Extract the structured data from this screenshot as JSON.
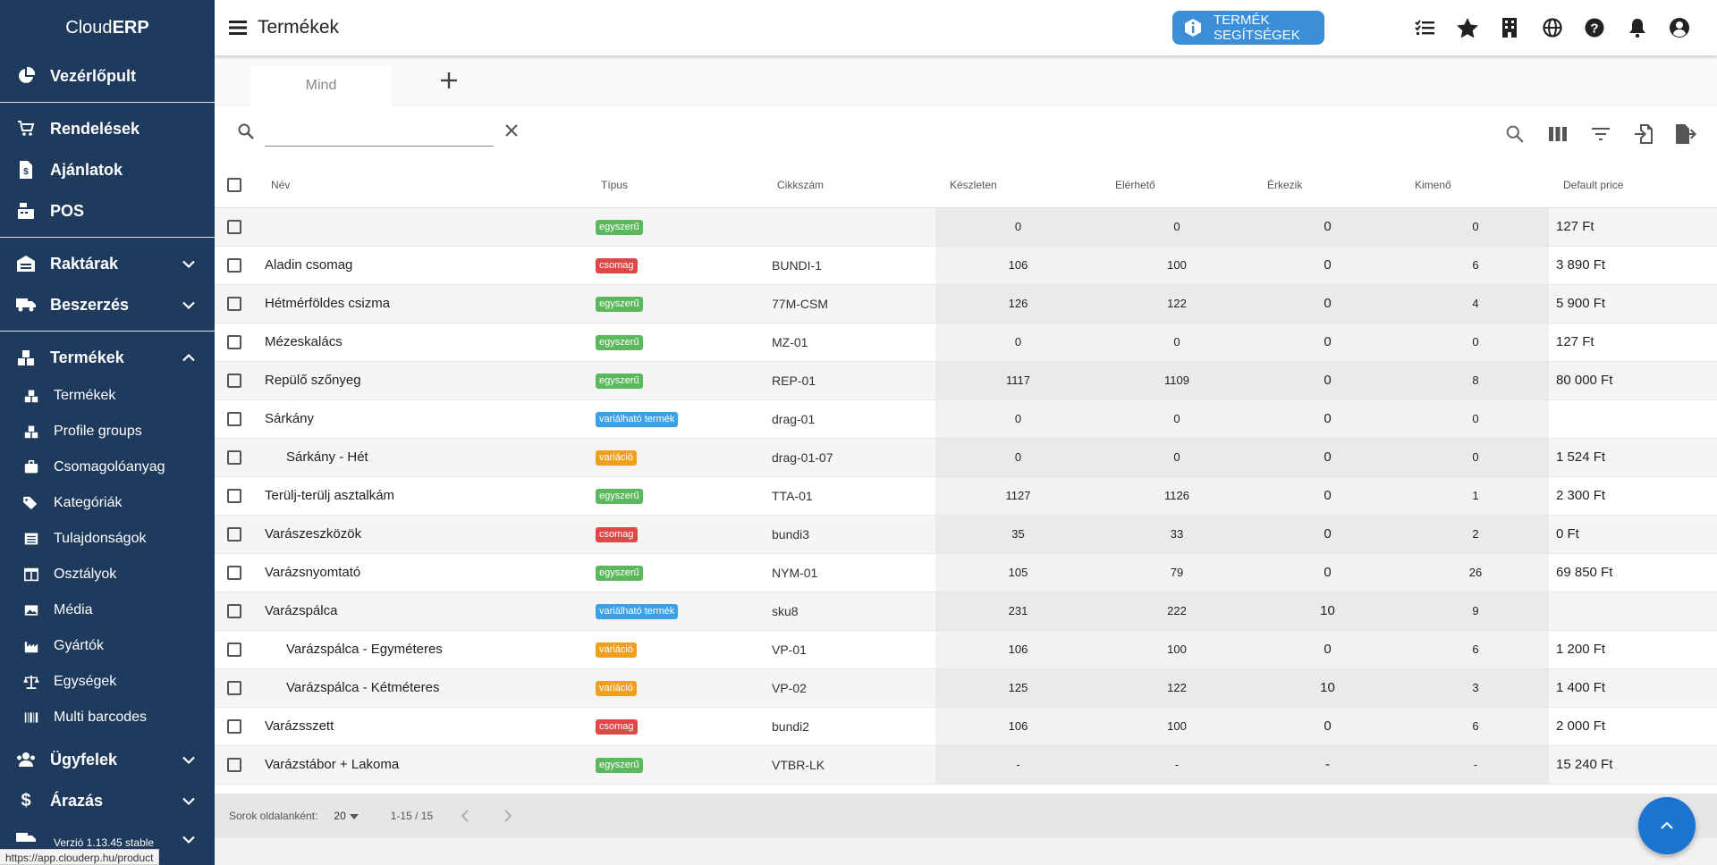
{
  "app": {
    "brand_prefix": "Cloud",
    "brand_suffix": "ERP",
    "status_url": "https://app.clouderp.hu/product",
    "version": "Verzió 1.13.45 stable"
  },
  "sidebar": {
    "dashboard": "Vezérlőpult",
    "orders": "Rendelések",
    "offers": "Ajánlatok",
    "pos": "POS",
    "warehouses": "Raktárak",
    "purchasing": "Beszerzés",
    "products": "Termékek",
    "sub": [
      "Termékek",
      "Profile groups",
      "Csomagolóanyag",
      "Kategóriák",
      "Tulajdonságok",
      "Osztályok",
      "Média",
      "Gyártók",
      "Egységek",
      "Multi barcodes"
    ],
    "customers": "Ügyfelek",
    "pricing": "Árazás"
  },
  "header": {
    "title": "Termékek",
    "help_label": "TERMÉK SEGÍTSÉGEK"
  },
  "tabs": {
    "all": "Mind"
  },
  "search": {
    "value": "",
    "placeholder": ""
  },
  "table": {
    "columns": [
      "Név",
      "Típus",
      "Cikkszám",
      "Készleten",
      "Elérhető",
      "Érkezik",
      "Kimenő",
      "Default price"
    ],
    "rows": [
      {
        "name": "",
        "type": "egyszerű",
        "sku": "",
        "stock": "0",
        "available": "0",
        "incoming": "0",
        "outgoing": "0",
        "price": "127 Ft"
      },
      {
        "name": "Aladin csomag",
        "type": "csomag",
        "sku": "BUNDI-1",
        "stock": "106",
        "available": "100",
        "incoming": "0",
        "outgoing": "6",
        "price": "3 890 Ft"
      },
      {
        "name": "Hétmérföldes csizma",
        "type": "egyszerű",
        "sku": "77M-CSM",
        "stock": "126",
        "available": "122",
        "incoming": "0",
        "outgoing": "4",
        "price": "5 900 Ft"
      },
      {
        "name": "Mézeskalács",
        "type": "egyszerű",
        "sku": "MZ-01",
        "stock": "0",
        "available": "0",
        "incoming": "0",
        "outgoing": "0",
        "price": "127 Ft"
      },
      {
        "name": "Repülő szőnyeg",
        "type": "egyszerű",
        "sku": "REP-01",
        "stock": "1117",
        "available": "1109",
        "incoming": "0",
        "outgoing": "8",
        "price": "80 000 Ft"
      },
      {
        "name": "Sárkány",
        "type": "variálható termék",
        "sku": "drag-01",
        "stock": "0",
        "available": "0",
        "incoming": "0",
        "outgoing": "0",
        "price": ""
      },
      {
        "name": "Sárkány - Hét",
        "type": "variáció",
        "sku": "drag-01-07",
        "stock": "0",
        "available": "0",
        "incoming": "0",
        "outgoing": "0",
        "price": "1 524 Ft"
      },
      {
        "name": "Terülj-terülj asztalkám",
        "type": "egyszerű",
        "sku": "TTA-01",
        "stock": "1127",
        "available": "1126",
        "incoming": "0",
        "outgoing": "1",
        "price": "2 300 Ft"
      },
      {
        "name": "Varászeszközök",
        "type": "csomag",
        "sku": "bundi3",
        "stock": "35",
        "available": "33",
        "incoming": "0",
        "outgoing": "2",
        "price": "0 Ft"
      },
      {
        "name": "Varázsnyomtató",
        "type": "egyszerű",
        "sku": "NYM-01",
        "stock": "105",
        "available": "79",
        "incoming": "0",
        "outgoing": "26",
        "price": "69 850 Ft"
      },
      {
        "name": "Varázspálca",
        "type": "variálható termék",
        "sku": "sku8",
        "stock": "231",
        "available": "222",
        "incoming": "10",
        "outgoing": "9",
        "price": ""
      },
      {
        "name": "Varázspálca - Egyméteres",
        "type": "variáció",
        "sku": "VP-01",
        "stock": "106",
        "available": "100",
        "incoming": "0",
        "outgoing": "6",
        "price": "1 200 Ft"
      },
      {
        "name": "Varázspálca - Kétméteres",
        "type": "variáció",
        "sku": "VP-02",
        "stock": "125",
        "available": "122",
        "incoming": "10",
        "outgoing": "3",
        "price": "1 400 Ft"
      },
      {
        "name": "Varázsszett",
        "type": "csomag",
        "sku": "bundi2",
        "stock": "106",
        "available": "100",
        "incoming": "0",
        "outgoing": "6",
        "price": "2 000 Ft"
      },
      {
        "name": "Varázstábor + Lakoma",
        "type": "egyszerű",
        "sku": "VTBR-LK",
        "stock": "-",
        "available": "-",
        "incoming": "-",
        "outgoing": "-",
        "price": "15 240 Ft"
      }
    ]
  },
  "footer": {
    "rows_per_page_label": "Sorok oldalanként:",
    "rows_per_page": "20",
    "range": "1-15 / 15"
  },
  "colors": {
    "sidebar": "#1e3a5c",
    "help_button": "#3a8fd8",
    "fab": "#1a75d1",
    "badge_simple": "#5cb85c",
    "badge_bundle": "#e04848",
    "badge_variable": "#3aa0e8",
    "badge_variation": "#f0a020"
  }
}
